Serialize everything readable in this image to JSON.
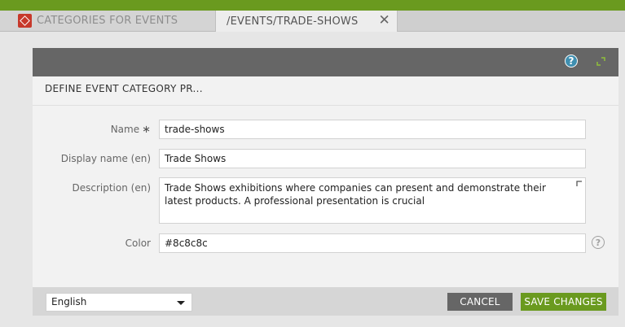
{
  "tabs": [
    {
      "label": "CATEGORIES FOR EVENTS",
      "icon": "app-logo-icon"
    },
    {
      "label": "/EVENTS/TRADE-SHOWS",
      "close_icon": "close-icon"
    }
  ],
  "panel": {
    "title": "DEFINE EVENT CATEGORY PR...",
    "header_icons": [
      "help-icon",
      "expand-icon"
    ]
  },
  "form": {
    "name": {
      "label": "Name",
      "required_mark": "∗",
      "value": "trade-shows"
    },
    "display_name": {
      "label": "Display name (en)",
      "value": "Trade Shows"
    },
    "description": {
      "label": "Description (en)",
      "value": "Trade Shows exhibitions where companies can present and demonstrate their latest products. A professional presentation is crucial"
    },
    "color": {
      "label": "Color",
      "value": "#8c8c8c",
      "help_icon": "help-icon"
    }
  },
  "footer": {
    "language": "English",
    "cancel_label": "CANCEL",
    "save_label": "SAVE CHANGES"
  },
  "colors": {
    "accent_green": "#6a9a1f",
    "header_gray": "#666666",
    "help_blue": "#3f8fb0"
  }
}
